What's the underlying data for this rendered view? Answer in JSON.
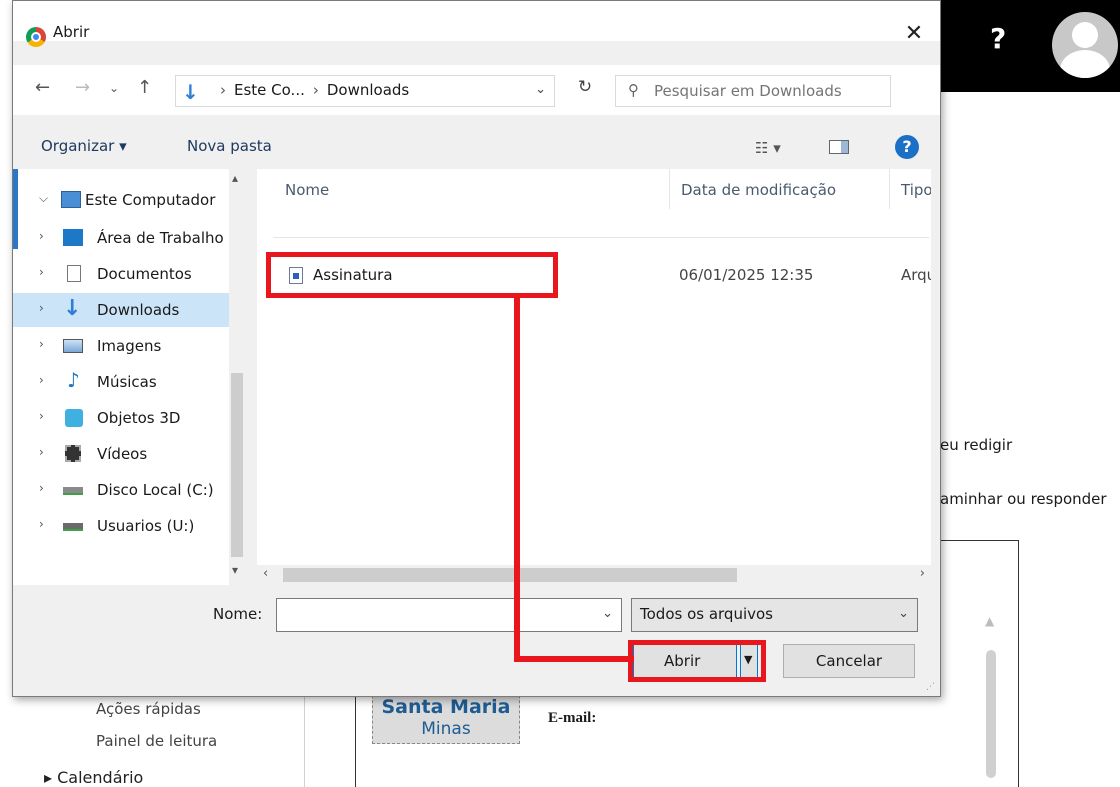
{
  "background": {
    "help_glyph": "?",
    "text_line1": "eu redigir",
    "text_line2": "aminhar ou responder",
    "logo_line1": "Santa Maria",
    "logo_line2": "Minas",
    "contact_email": "E-mail:",
    "left_items": [
      "Ações rápidas",
      "Painel de leitura"
    ],
    "calendar": "Calendário"
  },
  "dialog": {
    "title": "Abrir",
    "close_glyph": "✕",
    "address": {
      "crumbs": [
        "Este Co...",
        "Downloads"
      ]
    },
    "search": {
      "placeholder": "Pesquisar em Downloads"
    },
    "toolbar": {
      "organize": "Organizar ▾",
      "new_folder": "Nova pasta",
      "help": "?"
    },
    "tree": [
      {
        "label": "Este Computador",
        "icon": "computer-icon",
        "expanded": true
      },
      {
        "label": "Área de Trabalho",
        "icon": "desktop-icon"
      },
      {
        "label": "Documentos",
        "icon": "documents-icon"
      },
      {
        "label": "Downloads",
        "icon": "downloads-icon",
        "selected": true
      },
      {
        "label": "Imagens",
        "icon": "pictures-icon"
      },
      {
        "label": "Músicas",
        "icon": "music-icon"
      },
      {
        "label": "Objetos 3D",
        "icon": "objects3d-icon"
      },
      {
        "label": "Vídeos",
        "icon": "videos-icon"
      },
      {
        "label": "Disco Local (C:)",
        "icon": "drive-icon"
      },
      {
        "label": "Usuarios (U:)",
        "icon": "network-drive-icon"
      }
    ],
    "columns": {
      "name": "Nome",
      "date": "Data de modificação",
      "type": "Tipo"
    },
    "files": [
      {
        "name": "Assinatura",
        "date": "06/01/2025 12:35",
        "type": "Arqu"
      }
    ],
    "filename_label": "Nome:",
    "filename_value": "",
    "filter": "Todos os arquivos",
    "open_label": "Abrir",
    "cancel_label": "Cancelar"
  },
  "colors": {
    "annotation": "#e8161d",
    "selection": "#cce4f7",
    "accent": "#0078d7"
  }
}
